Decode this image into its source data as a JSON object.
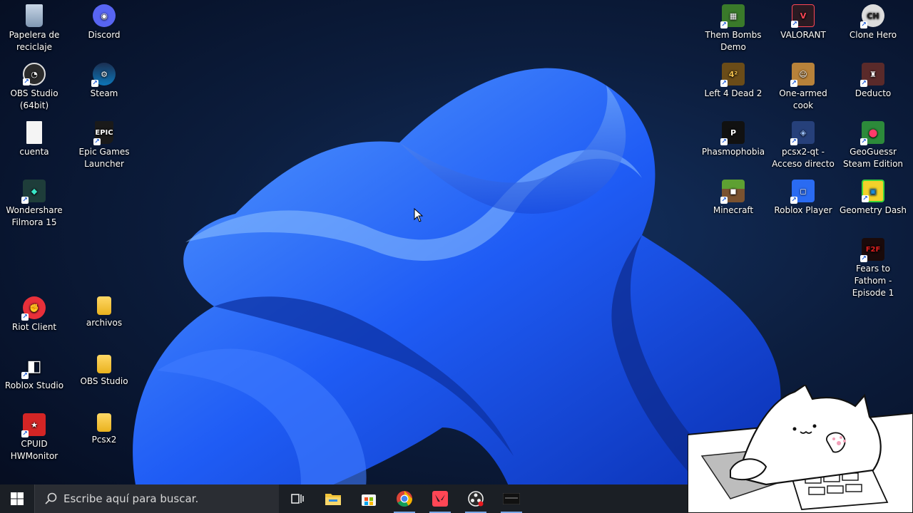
{
  "desktop": {
    "left_icons": [
      {
        "label": "Papelera de reciclaje",
        "icon": "recycle-bin-icon"
      },
      {
        "label": "Discord",
        "icon": "discord-icon"
      },
      {
        "label": "OBS Studio (64bit)",
        "icon": "obs-icon"
      },
      {
        "label": "Steam",
        "icon": "steam-icon"
      },
      {
        "label": "cuenta",
        "icon": "text-file-icon"
      },
      {
        "label": "Epic Games Launcher",
        "icon": "epic-games-icon"
      },
      {
        "label": "Wondershare Filmora 15",
        "icon": "filmora-icon"
      },
      {
        "label": "Riot Client",
        "icon": "riot-client-icon"
      },
      {
        "label": "archivos",
        "icon": "folder-icon"
      },
      {
        "label": "Roblox Studio",
        "icon": "roblox-studio-icon"
      },
      {
        "label": "OBS Studio",
        "icon": "folder-icon"
      },
      {
        "label": "CPUID HWMonitor",
        "icon": "hwmonitor-icon"
      },
      {
        "label": "Pcsx2",
        "icon": "folder-icon"
      }
    ],
    "right_icons": [
      {
        "label": "Them Bombs Demo",
        "icon": "them-bombs-icon"
      },
      {
        "label": "VALORANT",
        "icon": "valorant-icon"
      },
      {
        "label": "Clone Hero",
        "icon": "clone-hero-icon"
      },
      {
        "label": "Left 4 Dead 2",
        "icon": "left4dead2-icon"
      },
      {
        "label": "One-armed cook",
        "icon": "one-armed-cook-icon"
      },
      {
        "label": "Deducto",
        "icon": "deducto-icon"
      },
      {
        "label": "Phasmophobia",
        "icon": "phasmophobia-icon"
      },
      {
        "label": "pcsx2-qt - Acceso directo",
        "icon": "pcsx2-icon"
      },
      {
        "label": "GeoGuessr Steam Edition",
        "icon": "geoguessr-icon"
      },
      {
        "label": "Minecraft",
        "icon": "minecraft-icon"
      },
      {
        "label": "Roblox Player",
        "icon": "roblox-player-icon"
      },
      {
        "label": "Geometry Dash",
        "icon": "geometry-dash-icon"
      },
      {
        "label": "Fears to Fathom - Episode 1",
        "icon": "fears-to-fathom-icon"
      }
    ]
  },
  "taskbar": {
    "search_placeholder": "Escribe aquí para buscar.",
    "pinned": [
      {
        "name": "task-view",
        "icon": "task-view-icon"
      },
      {
        "name": "file-explorer",
        "icon": "file-explorer-icon"
      },
      {
        "name": "microsoft-store",
        "icon": "store-icon"
      },
      {
        "name": "chrome",
        "icon": "chrome-icon"
      },
      {
        "name": "valorant",
        "icon": "valorant-icon"
      },
      {
        "name": "obs-studio",
        "icon": "obs-icon"
      },
      {
        "name": "app-window",
        "icon": "app-window-icon"
      }
    ]
  },
  "colors": {
    "wallpaper_bloom": "#1f5cf5",
    "taskbar": "#1b1f25",
    "search_box": "#2a2d33"
  }
}
